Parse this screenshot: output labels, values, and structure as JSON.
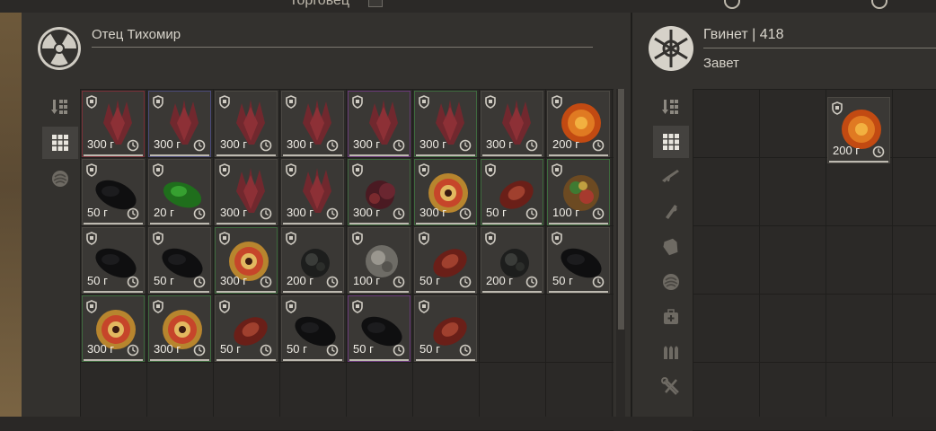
{
  "header": {
    "title": "Торговец"
  },
  "trader": {
    "name": "Отец Тихомир",
    "icon": "radiation-icon"
  },
  "player": {
    "name_line": "Гвинет | 418",
    "faction": "Завет",
    "icon": "faction-emblem-icon"
  },
  "trader_filters": [
    {
      "icon": "sort-icon",
      "active": false
    },
    {
      "icon": "grid-icon",
      "active": true
    },
    {
      "icon": "artifact-icon",
      "active": false
    }
  ],
  "player_filters": [
    {
      "icon": "sort-icon",
      "active": false
    },
    {
      "icon": "grid-icon",
      "active": true
    },
    {
      "icon": "rifle-icon",
      "active": false
    },
    {
      "icon": "attachment-icon",
      "active": false
    },
    {
      "icon": "armor-icon",
      "active": false
    },
    {
      "icon": "artifact-icon",
      "active": false
    },
    {
      "icon": "medkit-icon",
      "active": false
    },
    {
      "icon": "ammo-icon",
      "active": false
    },
    {
      "icon": "tools-icon",
      "active": false
    }
  ],
  "trader_items": [
    {
      "price": "300 г",
      "kind": "crystal",
      "border": "#7a3038"
    },
    {
      "price": "300 г",
      "kind": "crystal",
      "border": "#4a4a7a"
    },
    {
      "price": "300 г",
      "kind": "crystal",
      "border": "#4b4843"
    },
    {
      "price": "300 г",
      "kind": "crystal",
      "border": "#4b4843"
    },
    {
      "price": "300 г",
      "kind": "crystal",
      "border": "#6a3a7a"
    },
    {
      "price": "300 г",
      "kind": "crystal",
      "border": "#3e6a3e"
    },
    {
      "price": "300 г",
      "kind": "crystal",
      "border": "#4b4843"
    },
    {
      "price": "200 г",
      "kind": "fireball",
      "border": "#4b4843"
    },
    {
      "price": "50 г",
      "kind": "dark",
      "border": "#4b4843"
    },
    {
      "price": "20 г",
      "kind": "green",
      "border": "#4b4843"
    },
    {
      "price": "300 г",
      "kind": "crystal",
      "border": "#4b4843"
    },
    {
      "price": "300 г",
      "kind": "crystal",
      "border": "#4b4843"
    },
    {
      "price": "300 г",
      "kind": "blob",
      "border": "#3e6a3e"
    },
    {
      "price": "300 г",
      "kind": "swirl",
      "border": "#3e6a3e"
    },
    {
      "price": "50 г",
      "kind": "meat",
      "border": "#3e6a3e"
    },
    {
      "price": "100 г",
      "kind": "rainbow",
      "border": "#3e6a3e"
    },
    {
      "price": "50 г",
      "kind": "dark",
      "border": "#4b4843"
    },
    {
      "price": "50 г",
      "kind": "dark",
      "border": "#4b4843"
    },
    {
      "price": "300 г",
      "kind": "swirl",
      "border": "#3e6a3e"
    },
    {
      "price": "200 г",
      "kind": "rock",
      "border": "#4b4843"
    },
    {
      "price": "100 г",
      "kind": "rock-light",
      "border": "#4b4843"
    },
    {
      "price": "50 г",
      "kind": "meat",
      "border": "#4b4843"
    },
    {
      "price": "200 г",
      "kind": "rock",
      "border": "#4b4843"
    },
    {
      "price": "50 г",
      "kind": "dark",
      "border": "#4b4843"
    },
    {
      "price": "300 г",
      "kind": "swirl",
      "border": "#3e6a3e"
    },
    {
      "price": "300 г",
      "kind": "swirl",
      "border": "#3e6a3e"
    },
    {
      "price": "50 г",
      "kind": "meat",
      "border": "#4b4843"
    },
    {
      "price": "50 г",
      "kind": "dark",
      "border": "#4b4843"
    },
    {
      "price": "50 г",
      "kind": "dark",
      "border": "#6a3a7a"
    },
    {
      "price": "50 г",
      "kind": "meat",
      "border": "#4b4843"
    }
  ],
  "player_items": [
    {
      "price": "200 г",
      "kind": "fireball",
      "border": "#4b4843"
    }
  ]
}
